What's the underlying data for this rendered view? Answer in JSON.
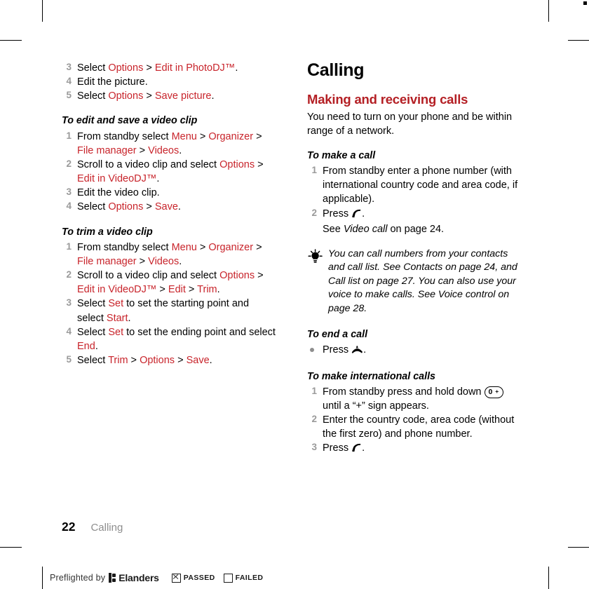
{
  "document": {
    "chapter_title": "Calling",
    "folio": {
      "page_number": "22",
      "chapter_label": "Calling"
    }
  },
  "left_column": {
    "continued_steps": [
      {
        "num": "3",
        "parts": [
          {
            "t": "Select ",
            "s": "plain"
          },
          {
            "t": "Options",
            "s": "hl"
          },
          {
            "t": " > ",
            "s": "plain"
          },
          {
            "t": "Edit in PhotoDJ™",
            "s": "hl"
          },
          {
            "t": ".",
            "s": "plain"
          }
        ]
      },
      {
        "num": "4",
        "parts": [
          {
            "t": "Edit the picture.",
            "s": "plain"
          }
        ]
      },
      {
        "num": "5",
        "parts": [
          {
            "t": "Select ",
            "s": "plain"
          },
          {
            "t": "Options",
            "s": "hl"
          },
          {
            "t": " > ",
            "s": "plain"
          },
          {
            "t": "Save picture",
            "s": "hl"
          },
          {
            "t": ".",
            "s": "plain"
          }
        ]
      }
    ],
    "procedures": [
      {
        "heading": "To edit and save a video clip",
        "steps": [
          {
            "num": "1",
            "parts": [
              {
                "t": "From standby select ",
                "s": "plain"
              },
              {
                "t": "Menu",
                "s": "hl"
              },
              {
                "t": " > ",
                "s": "plain"
              },
              {
                "t": "Organizer",
                "s": "hl"
              },
              {
                "t": " > ",
                "s": "plain"
              },
              {
                "t": "File manager",
                "s": "hl"
              },
              {
                "t": " > ",
                "s": "plain"
              },
              {
                "t": "Videos",
                "s": "hl"
              },
              {
                "t": ".",
                "s": "plain"
              }
            ]
          },
          {
            "num": "2",
            "parts": [
              {
                "t": "Scroll to a video clip and select ",
                "s": "plain"
              },
              {
                "t": "Options",
                "s": "hl"
              },
              {
                "t": " > ",
                "s": "plain"
              },
              {
                "t": "Edit in VideoDJ™",
                "s": "hl"
              },
              {
                "t": ".",
                "s": "plain"
              }
            ]
          },
          {
            "num": "3",
            "parts": [
              {
                "t": "Edit the video clip.",
                "s": "plain"
              }
            ]
          },
          {
            "num": "4",
            "parts": [
              {
                "t": "Select ",
                "s": "plain"
              },
              {
                "t": "Options",
                "s": "hl"
              },
              {
                "t": " > ",
                "s": "plain"
              },
              {
                "t": "Save",
                "s": "hl"
              },
              {
                "t": ".",
                "s": "plain"
              }
            ]
          }
        ]
      },
      {
        "heading": "To trim a video clip",
        "steps": [
          {
            "num": "1",
            "parts": [
              {
                "t": "From standby select ",
                "s": "plain"
              },
              {
                "t": "Menu",
                "s": "hl"
              },
              {
                "t": " > ",
                "s": "plain"
              },
              {
                "t": "Organizer",
                "s": "hl"
              },
              {
                "t": " > ",
                "s": "plain"
              },
              {
                "t": "File manager",
                "s": "hl"
              },
              {
                "t": " > ",
                "s": "plain"
              },
              {
                "t": "Videos",
                "s": "hl"
              },
              {
                "t": ".",
                "s": "plain"
              }
            ]
          },
          {
            "num": "2",
            "parts": [
              {
                "t": "Scroll to a video clip and select ",
                "s": "plain"
              },
              {
                "t": "Options",
                "s": "hl"
              },
              {
                "t": " > ",
                "s": "plain"
              },
              {
                "t": "Edit in VideoDJ™",
                "s": "hl"
              },
              {
                "t": " > ",
                "s": "plain"
              },
              {
                "t": "Edit",
                "s": "hl"
              },
              {
                "t": " > ",
                "s": "plain"
              },
              {
                "t": "Trim",
                "s": "hl"
              },
              {
                "t": ".",
                "s": "plain"
              }
            ]
          },
          {
            "num": "3",
            "parts": [
              {
                "t": "Select ",
                "s": "plain"
              },
              {
                "t": "Set",
                "s": "hl"
              },
              {
                "t": " to set the starting point and select ",
                "s": "plain"
              },
              {
                "t": "Start",
                "s": "hl"
              },
              {
                "t": ".",
                "s": "plain"
              }
            ]
          },
          {
            "num": "4",
            "parts": [
              {
                "t": "Select ",
                "s": "plain"
              },
              {
                "t": "Set",
                "s": "hl"
              },
              {
                "t": " to set the ending point and select ",
                "s": "plain"
              },
              {
                "t": "End",
                "s": "hl"
              },
              {
                "t": ".",
                "s": "plain"
              }
            ]
          },
          {
            "num": "5",
            "parts": [
              {
                "t": "Select ",
                "s": "plain"
              },
              {
                "t": "Trim",
                "s": "hl"
              },
              {
                "t": " > ",
                "s": "plain"
              },
              {
                "t": "Options",
                "s": "hl"
              },
              {
                "t": " > ",
                "s": "plain"
              },
              {
                "t": "Save",
                "s": "hl"
              },
              {
                "t": ".",
                "s": "plain"
              }
            ]
          }
        ]
      }
    ]
  },
  "right_column": {
    "section_heading": "Making and receiving calls",
    "intro": "You need to turn on your phone and be within range of a network.",
    "procedures": [
      {
        "heading": "To make a call",
        "steps": [
          {
            "num": "1",
            "parts": [
              {
                "t": "From standby enter a phone number (with international country code and area code, if applicable).",
                "s": "plain"
              }
            ]
          },
          {
            "num": "2",
            "parts": [
              {
                "t": "Press ",
                "s": "plain"
              },
              {
                "t": "",
                "s": "icon-call"
              },
              {
                "t": ".",
                "s": "plain"
              },
              {
                "t": "\n",
                "s": "break"
              },
              {
                "t": "See ",
                "s": "plain"
              },
              {
                "t": "Video call",
                "s": "it"
              },
              {
                "t": " on page 24.",
                "s": "plain"
              }
            ]
          }
        ]
      }
    ],
    "tip": {
      "icon": "lightbulb-icon",
      "text": "You can call numbers from your contacts and call list. See Contacts on page 24, and Call list on page 27. You can also use your voice to make calls. See Voice control on page 28."
    },
    "end_call_procedure": {
      "heading": "To end a call",
      "bullet_parts": [
        {
          "t": "Press ",
          "s": "plain"
        },
        {
          "t": "",
          "s": "icon-endcall"
        },
        {
          "t": ".",
          "s": "plain"
        }
      ]
    },
    "international_procedure": {
      "heading": "To make international calls",
      "steps": [
        {
          "num": "1",
          "parts": [
            {
              "t": "From standby press and hold down ",
              "s": "plain"
            },
            {
              "t": "0 +",
              "s": "key"
            },
            {
              "t": " until a “+” sign appears.",
              "s": "plain"
            }
          ]
        },
        {
          "num": "2",
          "parts": [
            {
              "t": "Enter the country code, area code (without the first zero) and phone number.",
              "s": "plain"
            }
          ]
        },
        {
          "num": "3",
          "parts": [
            {
              "t": "Press ",
              "s": "plain"
            },
            {
              "t": "",
              "s": "icon-call"
            },
            {
              "t": ".",
              "s": "plain"
            }
          ]
        }
      ]
    }
  },
  "preflight": {
    "label": "Preflighted by",
    "brand": "Elanders",
    "passed_label": "PASSED",
    "failed_label": "FAILED",
    "passed_checked": true,
    "failed_checked": false
  },
  "colors": {
    "heading_red": "#b41f24",
    "link_red": "#c8242b",
    "step_number_gray": "#9a9a9a",
    "folio_gray": "#8e8e8e"
  }
}
